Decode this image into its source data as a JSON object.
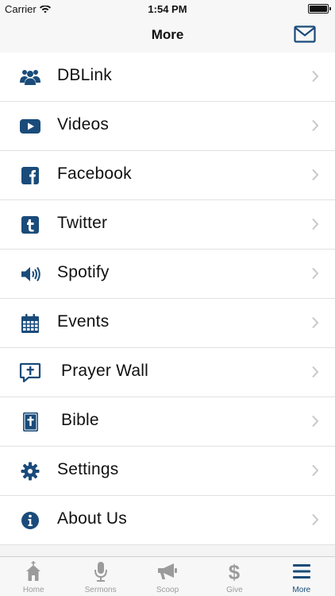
{
  "status_bar": {
    "carrier": "Carrier",
    "time": "1:54 PM"
  },
  "nav": {
    "title": "More"
  },
  "menu": [
    {
      "label": "DBLink",
      "icon": "users-icon"
    },
    {
      "label": "Videos",
      "icon": "play-icon"
    },
    {
      "label": "Facebook",
      "icon": "facebook-icon"
    },
    {
      "label": "Twitter",
      "icon": "tumblr-icon"
    },
    {
      "label": "Spotify",
      "icon": "speaker-icon"
    },
    {
      "label": "Events",
      "icon": "calendar-icon"
    },
    {
      "label": "Prayer Wall",
      "icon": "cross-speech-icon"
    },
    {
      "label": "Bible",
      "icon": "bible-icon"
    },
    {
      "label": "Settings",
      "icon": "gear-icon"
    },
    {
      "label": "About Us",
      "icon": "info-icon"
    }
  ],
  "tabs": [
    {
      "label": "Home",
      "icon": "church-icon",
      "active": false
    },
    {
      "label": "Sermons",
      "icon": "microphone-icon",
      "active": false
    },
    {
      "label": "Scoop",
      "icon": "megaphone-icon",
      "active": false
    },
    {
      "label": "Give",
      "icon": "dollar-icon",
      "active": false
    },
    {
      "label": "More",
      "icon": "menu-icon",
      "active": true
    }
  ],
  "colors": {
    "accent": "#1a4b7a",
    "inactive_tab": "#9b9b9b"
  }
}
